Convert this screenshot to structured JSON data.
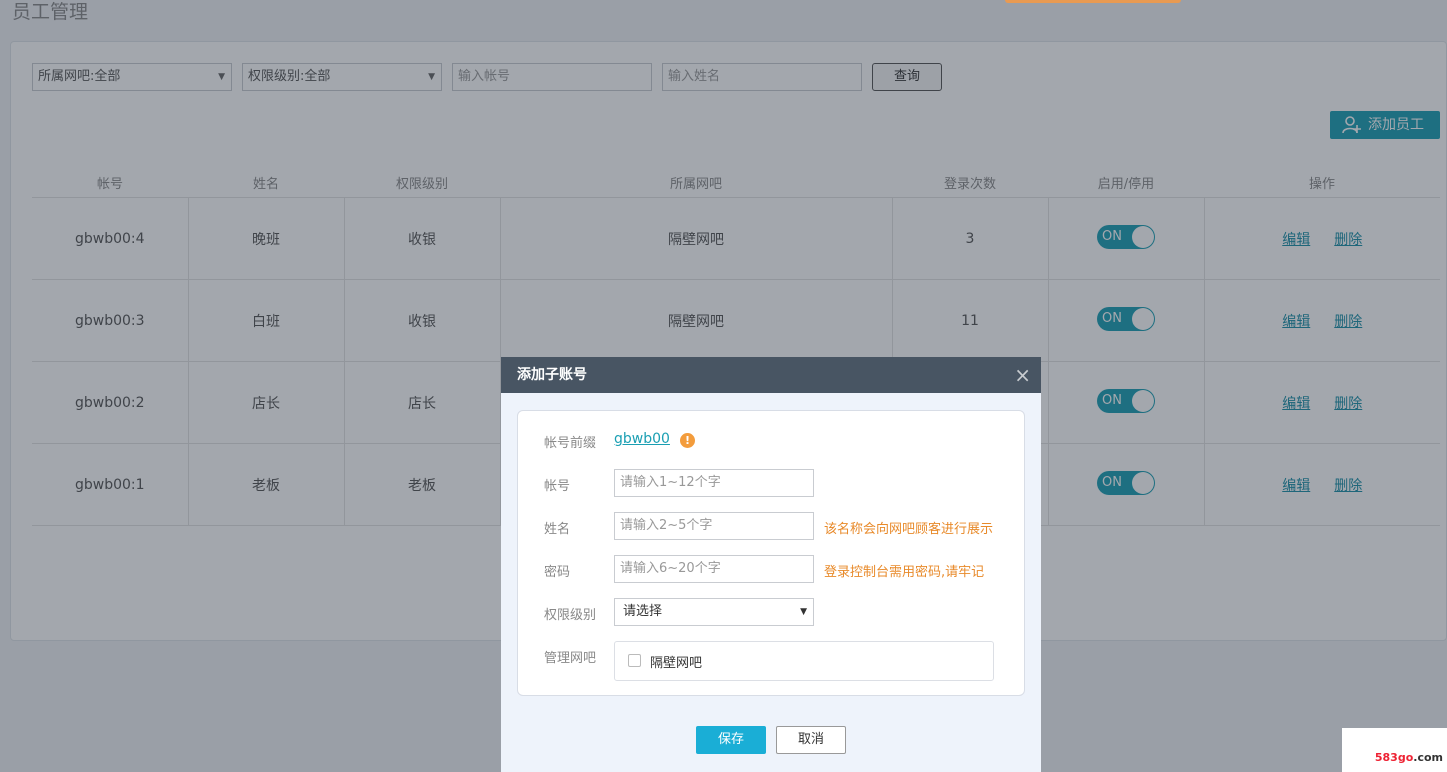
{
  "page": {
    "title": "员工管理"
  },
  "filters": {
    "cafe_select": "所属网吧:全部",
    "level_select": "权限级别:全部",
    "account_placeholder": "输入帐号",
    "name_placeholder": "输入姓名",
    "query_label": "查询"
  },
  "toolbar": {
    "add_label": "添加员工"
  },
  "table": {
    "headers": [
      "帐号",
      "姓名",
      "权限级别",
      "所属网吧",
      "登录次数",
      "启用/停用",
      "操作"
    ],
    "rows": [
      {
        "account": "gbwb00:4",
        "name": "晚班",
        "level": "收银",
        "cafe": "隔壁网吧",
        "logins": "3",
        "status": "ON",
        "edit": "编辑",
        "delete": "删除"
      },
      {
        "account": "gbwb00:3",
        "name": "白班",
        "level": "收银",
        "cafe": "隔壁网吧",
        "logins": "11",
        "status": "ON",
        "edit": "编辑",
        "delete": "删除"
      },
      {
        "account": "gbwb00:2",
        "name": "店长",
        "level": "店长",
        "cafe": "",
        "logins": "",
        "status": "ON",
        "edit": "编辑",
        "delete": "删除"
      },
      {
        "account": "gbwb00:1",
        "name": "老板",
        "level": "老板",
        "cafe": "",
        "logins": "",
        "status": "ON",
        "edit": "编辑",
        "delete": "删除"
      }
    ]
  },
  "modal": {
    "title": "添加子账号",
    "close": "×",
    "prefix_label": "帐号前缀",
    "prefix_value": "gbwb00",
    "info_glyph": "!",
    "account_label": "帐号",
    "account_placeholder": "请输入1~12个字",
    "name_label": "姓名",
    "name_placeholder": "请输入2~5个字",
    "name_hint": "该名称会向网吧顾客进行展示",
    "password_label": "密码",
    "password_placeholder": "请输入6~20个字",
    "password_hint": "登录控制台需用密码,请牢记",
    "level_label": "权限级别",
    "level_value": "请选择",
    "cafe_label": "管理网吧",
    "cafe_option": "隔壁网吧",
    "save_label": "保存",
    "cancel_label": "取消"
  },
  "watermark": {
    "prefix": "583go",
    "suffix": ".com"
  },
  "colors": {
    "accent": "#1a9fb3",
    "hint": "#e88a2a",
    "modal_header": "#485563"
  }
}
